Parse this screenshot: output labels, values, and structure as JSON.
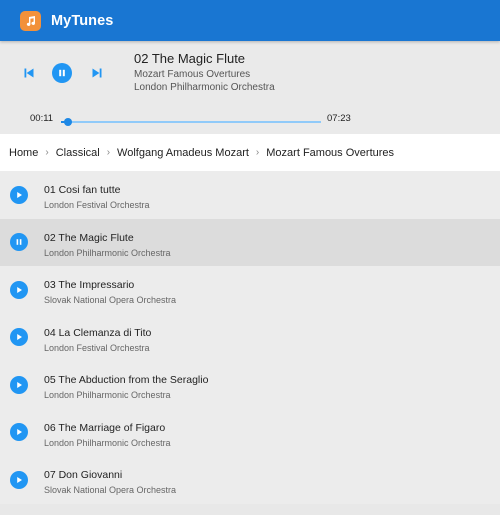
{
  "app": {
    "title": "MyTunes"
  },
  "colors": {
    "appbar": "#1976d2",
    "accent": "#2196f3",
    "logo": "#f2913a"
  },
  "player": {
    "now_playing": {
      "title": "02 The Magic Flute",
      "album": "Mozart Famous Overtures",
      "artist": "London Philharmonic Orchestra"
    },
    "current_time": "00:11",
    "total_time": "07:23",
    "progress": 0.025,
    "state": "playing",
    "controls": [
      "skip-previous-icon",
      "pause-icon",
      "skip-next-icon"
    ]
  },
  "breadcrumb": [
    "Home",
    "Classical",
    "Wolfgang Amadeus Mozart",
    "Mozart Famous Overtures"
  ],
  "tracks": [
    {
      "title": "01 Cosi fan tutte",
      "artist": "London Festival Orchestra",
      "active": false
    },
    {
      "title": "02 The Magic Flute",
      "artist": "London Philharmonic Orchestra",
      "active": true
    },
    {
      "title": "03 The Impressario",
      "artist": "Slovak National Opera Orchestra",
      "active": false
    },
    {
      "title": "04 La Clemanza di Tito",
      "artist": "London Festival Orchestra",
      "active": false
    },
    {
      "title": "05 The Abduction from the Seraglio",
      "artist": "London Philharmonic Orchestra",
      "active": false
    },
    {
      "title": "06 The Marriage of Figaro",
      "artist": "London Philharmonic Orchestra",
      "active": false
    },
    {
      "title": "07 Don Giovanni",
      "artist": "Slovak National Opera Orchestra",
      "active": false
    }
  ]
}
